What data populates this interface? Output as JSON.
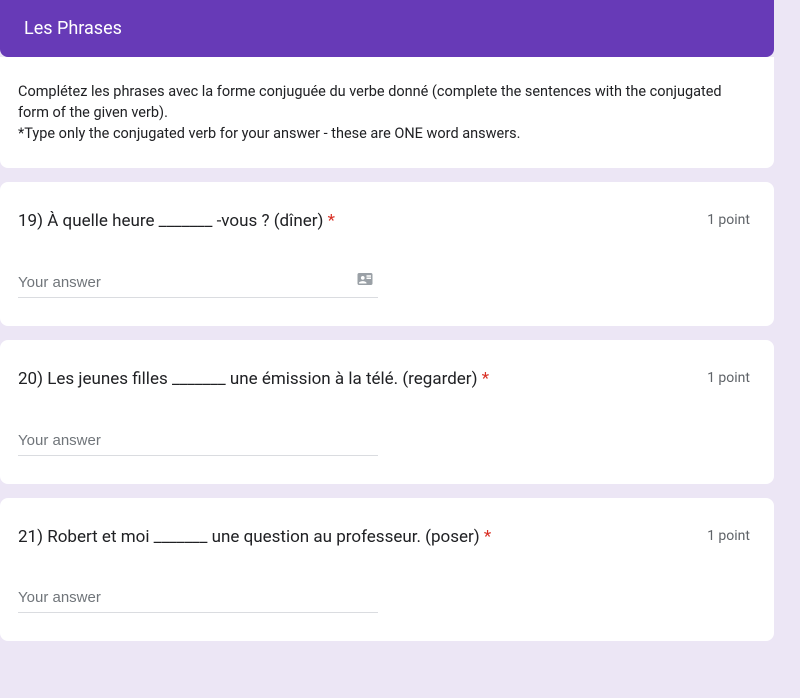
{
  "header": {
    "title": "Les Phrases"
  },
  "instructions": {
    "line1": "Complétez les phrases avec la forme conjuguée du verbe donné (complete the sentences with the conjugated form of the given verb).",
    "line2": "*Type only the conjugated verb for your answer - these are ONE word answers."
  },
  "questions": [
    {
      "text": "19) À quelle heure _______ -vous ? (dîner)",
      "required": "*",
      "points": "1 point",
      "placeholder": "Your answer",
      "show_autofill_icon": true
    },
    {
      "text": "20) Les jeunes filles _______ une émission à la télé. (regarder)",
      "required": "*",
      "points": "1 point",
      "placeholder": "Your answer",
      "show_autofill_icon": false
    },
    {
      "text": "21) Robert et moi _______ une question au professeur. (poser)",
      "required": "*",
      "points": "1 point",
      "placeholder": "Your answer",
      "show_autofill_icon": false
    }
  ]
}
